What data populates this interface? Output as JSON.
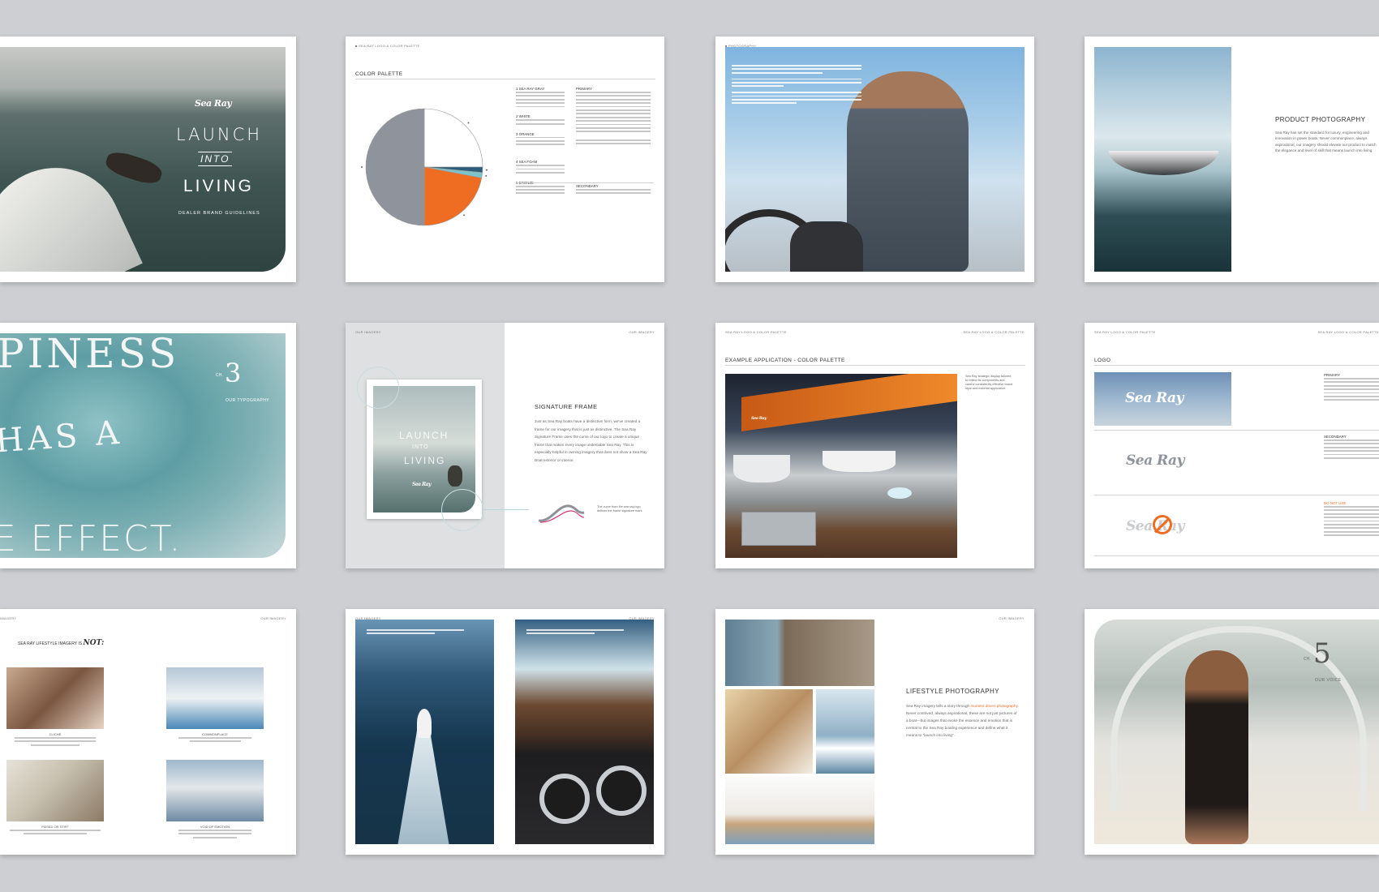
{
  "colors": {
    "background": "#cdcfd2",
    "orange": "#ef6d22",
    "gray": "#8f939b",
    "teal": "#7ec3cc"
  },
  "spread1": {
    "logo": "Sea Ray",
    "title_line1": "LAUNCH",
    "title_line2": "INTO",
    "title_line3": "LIVING",
    "subtitle": "DEALER BRAND GUIDELINES"
  },
  "spread2": {
    "title": "COLOR PALETTE",
    "chart_data": {
      "type": "pie",
      "title": "",
      "slices": [
        {
          "label": "SEA RAY GRAY",
          "value": 50,
          "color": "#8f939b"
        },
        {
          "label": "WHITE",
          "value": 25,
          "color": "#ffffff"
        },
        {
          "label": "BLUE",
          "value": 1.5,
          "color": "#2c5d7a"
        },
        {
          "label": "TEAL",
          "value": 1.5,
          "color": "#7ec3cc"
        },
        {
          "label": "ORANGE",
          "value": 22,
          "color": "#ef6d22"
        }
      ],
      "legend": "none"
    },
    "swatches": [
      "1 SEA RAY GRAY",
      "2 WHITE",
      "3 ORANGE",
      "4 SEA FOAM",
      "5 BRONZE"
    ],
    "primary_label": "PRIMARY",
    "secondary_label": "SECONDARY"
  },
  "spread3": {
    "section": "PHOTOGRAPHY"
  },
  "spread4": {
    "heading": "PRODUCT PHOTOGRAPHY",
    "body": "Sea Ray has set the standard for luxury, engineering and innovation in power boats. Never commonplace, always aspirational, our imagery should elevate our product to match the elegance and level of skill that means launch into living."
  },
  "spread5": {
    "big_top": "PINESS",
    "big_mid": "HAS A",
    "big_bottom": "E EFFECT.",
    "ch_label": "CH.",
    "ch_number": "3",
    "ch_name": "OUR TYPOGRAPHY"
  },
  "spread6": {
    "header_left": "OUR IMAGERY",
    "header_right": "OUR IMAGERY",
    "heading": "SIGNATURE FRAME",
    "body": "Just as Sea Ray boats have a distinctive form, we've created a frame for our imagery that is just as distinctive. The Sea Ray Signature Frame uses the curve of our logo to create a unique frame that makes every image undeniable Sea Ray. This is especially helpful in owning imagery that does not show a Sea Ray Boat exterior or interior.",
    "inset_line1": "LAUNCH",
    "inset_line2": "INTO",
    "inset_line3": "LIVING",
    "inset_logo": "Sea Ray",
    "note": "The curve from the sea ray logo defines the frame signature mark"
  },
  "spread7": {
    "header_left": "SEA RAY LOGO & COLOR PALETTE",
    "header_right": "SEA RAY LOGO & COLOR PALETTE",
    "title": "EXAMPLE APPLICATION - COLOR PALETTE",
    "sign_logo": "Sea Ray",
    "side_note": "Sea Ray strategic display tailored to reflect its components and careful consistently effective brand style and material application."
  },
  "spread8": {
    "header_left": "SEA RAY LOGO & COLOR PALETTE",
    "header_right": "SEA RAY LOGO & COLOR PALETTE",
    "title": "LOGO",
    "logo_text": "Sea Ray",
    "primary_label": "PRIMARY",
    "secondary_label": "SECONDARY",
    "donot_label": "DO NOT USE"
  },
  "spread9": {
    "header_left": "IMAGERY",
    "header_right": "OUR IMAGERY",
    "title": "SEA RAY LIFESTYLE IMAGERY IS",
    "title_em": "NOT:",
    "captions": [
      "CLICHÉ",
      "COMMONPLACE",
      "POSED OR STIFF",
      "VOID OF EMOTION"
    ]
  },
  "spread10": {
    "header_left": "OUR IMAGERY",
    "header_right": "OUR IMAGERY"
  },
  "spread11": {
    "header_right": "OUR IMAGERY",
    "heading": "LIFESTYLE PHOTOGRAPHY",
    "body_start": "Sea Ray imagery tells a story through",
    "body_highlight": "moment driven photography",
    "body_end": ". Never contrived, always aspirational, these are not just pictures of a boat—but images that evoke the essence and emotion that is central to the Sea Ray boating experience and define what it means to \"launch into living\"."
  },
  "spread12": {
    "ch_label": "CH.",
    "ch_number": "5",
    "ch_name": "OUR VOICE"
  }
}
